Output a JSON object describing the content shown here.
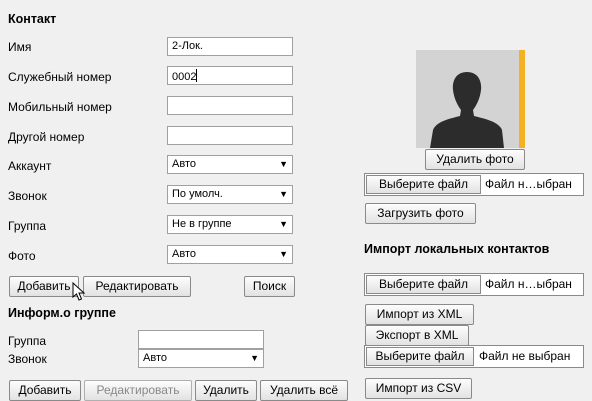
{
  "contact": {
    "heading": "Контакт",
    "fields": {
      "name": {
        "label": "Имя",
        "value": "2-Лок."
      },
      "work_number": {
        "label": "Служебный номер",
        "value": "0002"
      },
      "mobile_number": {
        "label": "Мобильный номер",
        "value": ""
      },
      "other_number": {
        "label": "Другой номер",
        "value": ""
      },
      "account": {
        "label": "Аккаунт",
        "value": "Авто"
      },
      "ring": {
        "label": "Звонок",
        "value": "По умолч."
      },
      "group": {
        "label": "Группа",
        "value": "Не в группе"
      },
      "photo": {
        "label": "Фото",
        "value": "Авто"
      }
    },
    "buttons": {
      "add": "Добавить",
      "edit": "Редактировать",
      "search": "Поиск"
    }
  },
  "group_info": {
    "heading": "Информ.о группе",
    "fields": {
      "group": {
        "label": "Группа",
        "value": ""
      },
      "ring": {
        "label": "Звонок",
        "value": "Авто"
      }
    },
    "buttons": {
      "add": "Добавить",
      "edit": "Редактировать",
      "delete": "Удалить",
      "delete_all": "Удалить всё"
    }
  },
  "photo_panel": {
    "avatar_icon": "person-silhouette-icon",
    "accent_color": "#f4b223",
    "delete_photo": "Удалить фото",
    "file_choose": "Выберите файл",
    "file_status": "Файл н…ыбран",
    "upload_photo": "Загрузить фото"
  },
  "import_section": {
    "heading": "Импорт локальных контактов",
    "file1_choose": "Выберите файл",
    "file1_status": "Файл н…ыбран",
    "import_xml": "Импорт из XML",
    "export_xml": "Экспорт в XML",
    "file2_choose": "Выберите файл",
    "file2_status": "Файл не выбран",
    "import_csv": "Импорт из CSV"
  }
}
